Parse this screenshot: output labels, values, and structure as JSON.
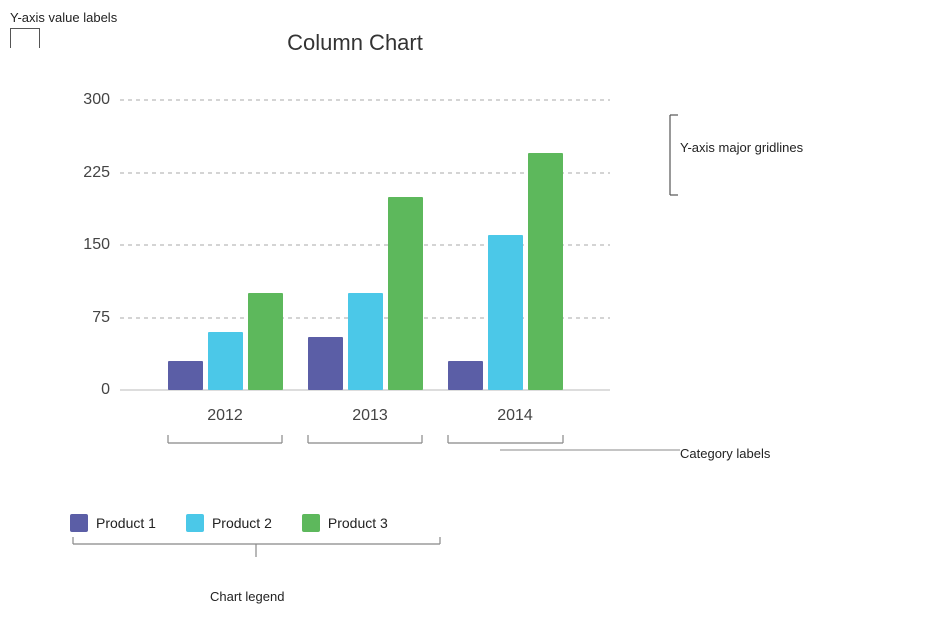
{
  "chart": {
    "title": "Column Chart",
    "yAxis": {
      "labels": [
        "0",
        "75",
        "150",
        "225",
        "300"
      ],
      "values": [
        0,
        75,
        150,
        225,
        300
      ],
      "max": 300
    },
    "categories": [
      "2012",
      "2013",
      "2014"
    ],
    "series": [
      {
        "name": "Product 1",
        "color": "#5B5EA6",
        "values": [
          30,
          55,
          30
        ]
      },
      {
        "name": "Product 2",
        "color": "#4BC8E8",
        "values": [
          60,
          100,
          160
        ]
      },
      {
        "name": "Product 3",
        "color": "#5DB85C",
        "values": [
          100,
          200,
          245
        ]
      }
    ],
    "annotations": {
      "yAxisValueLabels": "Y-axis value labels",
      "yAxisMajorGridlines": "Y-axis major gridlines",
      "categoryLabels": "Category labels",
      "chartLegend": "Chart legend"
    }
  }
}
